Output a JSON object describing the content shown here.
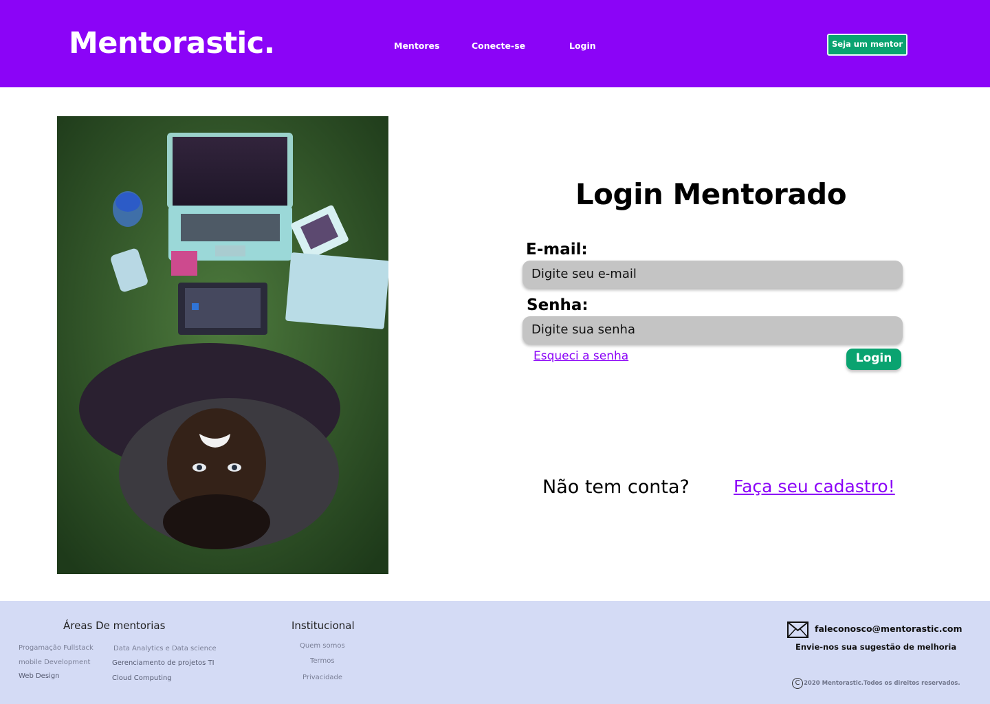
{
  "header": {
    "logo": "Mentorastic.",
    "nav": [
      "Mentores",
      "Conecte-se",
      "Login"
    ],
    "cta": "Seja um mentor"
  },
  "image": {
    "icon": "person-with-laptop-photo"
  },
  "login": {
    "title": "Login Mentorado",
    "email_label": "E-mail:",
    "email_placeholder": "Digite seu e-mail",
    "password_label": "Senha:",
    "password_placeholder": "Digite sua senha",
    "forgot": "Esqueci a senha",
    "submit": "Login",
    "no_account": "Não tem conta?",
    "signup": "Faça seu cadastro!"
  },
  "footer": {
    "areas_title": "Áreas De mentorias",
    "areas": [
      "Progamação Fullstack",
      "mobile Development",
      "Web Design",
      "Data Analytics e Data science",
      "Gerenciamento de projetos TI",
      "Cloud Computing"
    ],
    "inst_title": "Institucional",
    "inst": [
      "Quem somos",
      "Termos",
      "Privacidade"
    ],
    "email": "faleconosco@mentorastic.com",
    "suggestion": "Envie-nos sua sugestão de melhoria",
    "copyright_symbol": "C",
    "copyright": "2020 Mentorastic.Todos os direitos reservados."
  },
  "colors": {
    "brand": "#8b04f7",
    "accent": "#0aa370",
    "footer_bg": "#d4dbf5"
  }
}
